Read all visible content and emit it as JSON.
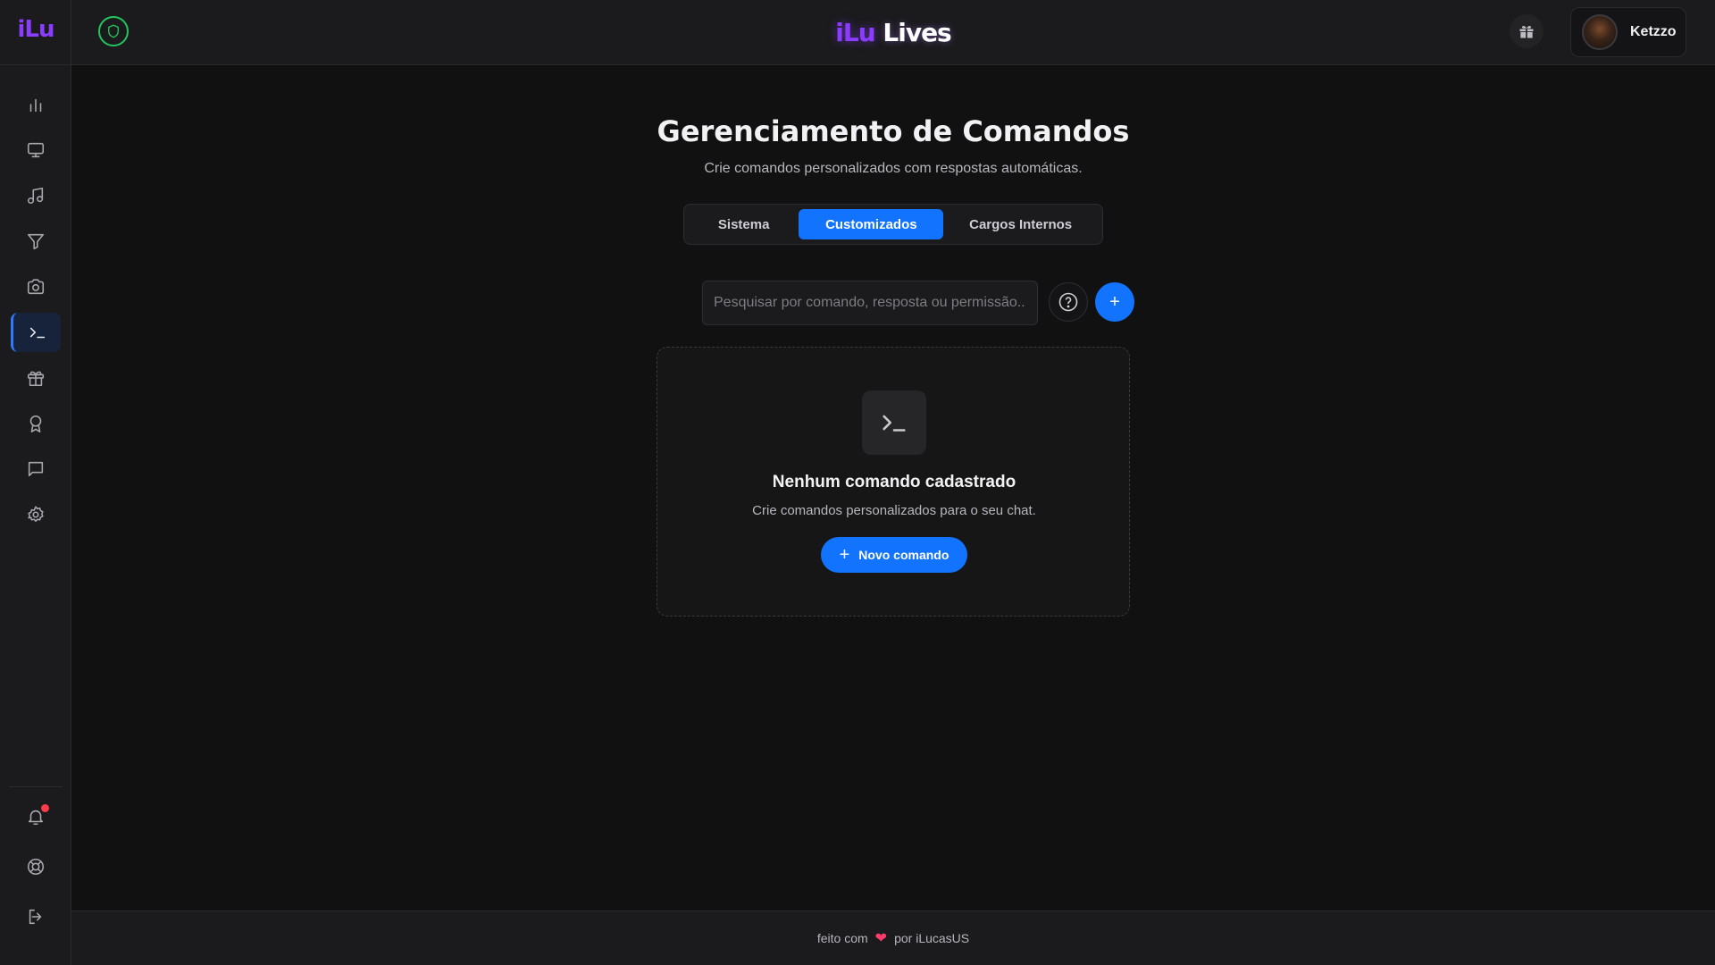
{
  "sidebar": {
    "logo": "iLu",
    "items": [
      {
        "icon": "chart-icon"
      },
      {
        "icon": "monitor-icon"
      },
      {
        "icon": "music-icon"
      },
      {
        "icon": "filter-icon"
      },
      {
        "icon": "camera-icon"
      },
      {
        "icon": "terminal-icon",
        "active": true
      },
      {
        "icon": "gift-icon"
      },
      {
        "icon": "award-icon"
      },
      {
        "icon": "chat-icon"
      },
      {
        "icon": "gear-icon"
      }
    ],
    "bottom_items": [
      {
        "icon": "bell-icon",
        "notification": true
      },
      {
        "icon": "lifebuoy-icon"
      },
      {
        "icon": "logout-icon"
      }
    ]
  },
  "header": {
    "brand_part1": "iLu",
    "brand_part2": "Lives",
    "user_name": "Ketzzo",
    "status_color": "#22c55e"
  },
  "main": {
    "title": "Gerenciamento de Comandos",
    "subtitle": "Crie comandos personalizados com respostas automáticas.",
    "tabs": [
      {
        "label": "Sistema",
        "active": false
      },
      {
        "label": "Customizados",
        "active": true
      },
      {
        "label": "Cargos Internos",
        "active": false
      }
    ],
    "search": {
      "placeholder": "Pesquisar por comando, resposta ou permissão...",
      "value": ""
    },
    "add_label": "+",
    "empty_state": {
      "title": "Nenhum comando cadastrado",
      "subtitle": "Crie comandos personalizados para o seu chat.",
      "button_label": "Novo comando"
    }
  },
  "footer": {
    "prefix": "feito com",
    "suffix": "por iLucasUS"
  },
  "colors": {
    "accent": "#1273ff",
    "brand": "#8b3dff",
    "background": "#111112",
    "panel": "#1b1b1d"
  }
}
